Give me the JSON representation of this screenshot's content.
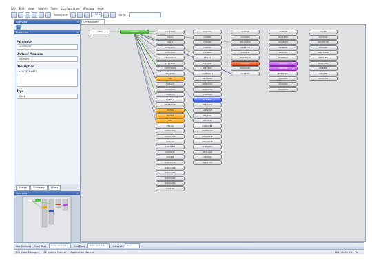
{
  "menu": [
    "File",
    "Edit",
    "View",
    "Search",
    "Tools",
    "Configuration",
    "Window",
    "Help"
  ],
  "toolbar": {
    "zoom_label": "Zoom Level",
    "zoom_value": "100%",
    "goto_label": "Go To:"
  },
  "left_panel": {
    "overview_title": "Overview",
    "properties_title": "Properties",
    "parameter_label": "Parameter",
    "parameter_value": "HESFRWEE",
    "units_label": "Units of Measure",
    "units_value": "(ESRWRT)",
    "description_label": "Description",
    "description_value": "HESI (ESRWRT)",
    "type_label": "Type",
    "type_value": "Stack",
    "tabs": [
      "Search",
      "Summary",
      "Filters"
    ],
    "overview_map_title": "Overview"
  },
  "document_tab": "CPPManager",
  "graph": {
    "nodes": [
      {
        "id": "n0",
        "label": "HESI",
        "style": "root",
        "col": 0,
        "row": 0
      },
      {
        "id": "n1",
        "label": "ESRWRT",
        "style": "green",
        "col": 1,
        "row": 0
      },
      {
        "id": "c2_0",
        "label": "CUTTORP",
        "style": "gray",
        "col": 2,
        "row": 0
      },
      {
        "id": "c2_1",
        "label": "CGAA",
        "style": "gray",
        "col": 2,
        "row": 1
      },
      {
        "id": "c2_2",
        "label": "CGLO",
        "style": "gray",
        "col": 2,
        "row": 2
      },
      {
        "id": "c2_3",
        "label": "CTGLASS",
        "style": "gray",
        "col": 2,
        "row": 3
      },
      {
        "id": "c2_4",
        "label": "CTPCLOU",
        "style": "gray",
        "col": 2,
        "row": 4
      },
      {
        "id": "c2_5",
        "label": "CTCLOUDHI",
        "style": "gray",
        "col": 2,
        "row": 5
      },
      {
        "id": "c2_6",
        "label": "CTGPMAP",
        "style": "gray",
        "col": 2,
        "row": 6
      },
      {
        "id": "c2_7",
        "label": "EARTHLOW",
        "style": "gray",
        "col": 2,
        "row": 7
      },
      {
        "id": "c2_8",
        "label": "EAGRUM",
        "style": "gray",
        "col": 2,
        "row": 8
      },
      {
        "id": "c2_9",
        "label": "HEI",
        "style": "orange",
        "col": 2,
        "row": 9
      },
      {
        "id": "c2_10",
        "label": "HANGCT",
        "style": "gray",
        "col": 2,
        "row": 10
      },
      {
        "id": "c2_11",
        "label": "HASDPHR",
        "style": "gray",
        "col": 2,
        "row": 11
      },
      {
        "id": "c2_12",
        "label": "HDENSITY",
        "style": "gray",
        "col": 2,
        "row": 12
      },
      {
        "id": "c2_13",
        "label": "HGEFLH",
        "style": "gray",
        "col": 2,
        "row": 13
      },
      {
        "id": "c2_14",
        "label": "HGRNLOW",
        "style": "gray",
        "col": 2,
        "row": 14
      },
      {
        "id": "c2_15",
        "label": "HOHM",
        "style": "orange",
        "col": 2,
        "row": 15
      },
      {
        "id": "c2_16",
        "label": "HOHLB",
        "style": "orange",
        "col": 2,
        "row": 16
      },
      {
        "id": "c2_17",
        "label": "HIC",
        "style": "orange",
        "col": 2,
        "row": 17
      },
      {
        "id": "c2_18",
        "label": "PWLOA",
        "style": "gray",
        "col": 2,
        "row": 18
      },
      {
        "id": "c2_19",
        "label": "PWMCHSA",
        "style": "gray",
        "col": 2,
        "row": 19
      },
      {
        "id": "c2_20",
        "label": "PWMCHLS",
        "style": "gray",
        "col": 2,
        "row": 20
      },
      {
        "id": "c2_21",
        "label": "SCRICO",
        "style": "gray",
        "col": 2,
        "row": 21
      },
      {
        "id": "c2_22",
        "label": "SLWTEMP",
        "style": "gray",
        "col": 2,
        "row": 22
      },
      {
        "id": "c2_23",
        "label": "SCRWOE",
        "style": "gray",
        "col": 2,
        "row": 23
      },
      {
        "id": "c2_24",
        "label": "SCRRIE",
        "style": "gray",
        "col": 2,
        "row": 24
      },
      {
        "id": "c2_25",
        "label": "SHELTEMP",
        "style": "gray",
        "col": 2,
        "row": 25
      },
      {
        "id": "c2_26",
        "label": "SWCOLBR",
        "style": "gray",
        "col": 2,
        "row": 26
      },
      {
        "id": "c2_27",
        "label": "SWCOLBR",
        "style": "gray",
        "col": 2,
        "row": 27
      },
      {
        "id": "c2_28",
        "label": "SWHOLBR",
        "style": "gray",
        "col": 2,
        "row": 28
      },
      {
        "id": "c2_29",
        "label": "SWHOLBR",
        "style": "gray",
        "col": 2,
        "row": 29
      },
      {
        "id": "c2_30",
        "label": "TCOTOR",
        "style": "gray",
        "col": 2,
        "row": 30
      },
      {
        "id": "c3_0",
        "label": "COLDTIG",
        "style": "gray",
        "col": 3,
        "row": 0
      },
      {
        "id": "c3_1",
        "label": "CGPPIN",
        "style": "gray",
        "col": 3,
        "row": 1
      },
      {
        "id": "c3_2",
        "label": "CTGAIN",
        "style": "gray",
        "col": 3,
        "row": 2
      },
      {
        "id": "c3_3",
        "label": "CTREAT",
        "style": "gray",
        "col": 3,
        "row": 3
      },
      {
        "id": "c3_4",
        "label": "CTDMSO",
        "style": "gray",
        "col": 3,
        "row": 4
      },
      {
        "id": "c3_5",
        "label": "DEGAS",
        "style": "gray",
        "col": 3,
        "row": 5
      },
      {
        "id": "c3_6",
        "label": "DIBHEAT",
        "style": "gray",
        "col": 3,
        "row": 6
      },
      {
        "id": "c3_7",
        "label": "DIESEAT",
        "style": "gray",
        "col": 3,
        "row": 7
      },
      {
        "id": "c3_8",
        "label": "DAMPLOLI",
        "style": "gray",
        "col": 3,
        "row": 8
      },
      {
        "id": "c3_9",
        "label": "SPLDVIBE",
        "style": "gray",
        "col": 3,
        "row": 9
      },
      {
        "id": "c3_10",
        "label": "LOWDTGT",
        "style": "gray",
        "col": 3,
        "row": 10
      },
      {
        "id": "c3_11",
        "label": "NORMTGL",
        "style": "gray",
        "col": 3,
        "row": 11
      },
      {
        "id": "c3_12",
        "label": "OVERPAS",
        "style": "gray",
        "col": 3,
        "row": 12
      },
      {
        "id": "c3_13",
        "label": "NTBURN",
        "style": "blue",
        "col": 3,
        "row": 13
      },
      {
        "id": "c3_14",
        "label": "PRE_MUX",
        "style": "gray",
        "col": 3,
        "row": 14
      },
      {
        "id": "c3_15",
        "label": "SCRNGSE",
        "style": "gray",
        "col": 3,
        "row": 15
      },
      {
        "id": "c3_16",
        "label": "SHUTTOL",
        "style": "gray",
        "col": 3,
        "row": 16
      },
      {
        "id": "c3_17",
        "label": "SHCDESE",
        "style": "gray",
        "col": 3,
        "row": 17
      },
      {
        "id": "c3_18",
        "label": "SWNGSEE",
        "style": "gray",
        "col": 3,
        "row": 18
      },
      {
        "id": "c3_19",
        "label": "SWPMGWA",
        "style": "gray",
        "col": 3,
        "row": 19
      },
      {
        "id": "c3_20",
        "label": "SWSGEDE",
        "style": "gray",
        "col": 3,
        "row": 20
      },
      {
        "id": "c3_21",
        "label": "SWVGEDE",
        "style": "gray",
        "col": 3,
        "row": 21
      },
      {
        "id": "c3_22",
        "label": "SHRDDEO",
        "style": "gray",
        "col": 3,
        "row": 22
      },
      {
        "id": "c3_23",
        "label": "UNTLOAD",
        "style": "gray",
        "col": 3,
        "row": 23
      },
      {
        "id": "c3_24",
        "label": "UNTOAD",
        "style": "gray",
        "col": 3,
        "row": 24
      },
      {
        "id": "c3_25",
        "label": "VARIPTOL",
        "style": "gray",
        "col": 3,
        "row": 25
      },
      {
        "id": "c4_0",
        "label": "COEHIR",
        "style": "gray",
        "col": 4,
        "row": 0
      },
      {
        "id": "c4_1",
        "label": "COCORR",
        "style": "gray",
        "col": 4,
        "row": 1
      },
      {
        "id": "c4_2",
        "label": "DELOGRHI",
        "style": "gray",
        "col": 4,
        "row": 2
      },
      {
        "id": "c4_3",
        "label": "GREATTE",
        "style": "gray",
        "col": 4,
        "row": 3
      },
      {
        "id": "c4_4",
        "label": "NHGSUP",
        "style": "gray",
        "col": 4,
        "row": 4
      },
      {
        "id": "c4_5",
        "label": "NORMLLIO",
        "style": "gray",
        "col": 4,
        "row": 5
      },
      {
        "id": "c4_6",
        "label": "NCHARM",
        "style": "red",
        "col": 4,
        "row": 6
      },
      {
        "id": "c4_7",
        "label": "ROWLOPA",
        "style": "gray",
        "col": 4,
        "row": 7
      },
      {
        "id": "c4_8",
        "label": "SOCPPIN",
        "style": "gray",
        "col": 4,
        "row": 8
      },
      {
        "id": "c5_0",
        "label": "COBHIR",
        "style": "gray",
        "col": 5,
        "row": 0
      },
      {
        "id": "c5_1",
        "label": "GCLSTHR",
        "style": "gray",
        "col": 5,
        "row": 1
      },
      {
        "id": "c5_2",
        "label": "GKGBHIR",
        "style": "gray",
        "col": 5,
        "row": 2
      },
      {
        "id": "c5_3",
        "label": "NKMRPR",
        "style": "gray",
        "col": 5,
        "row": 3
      },
      {
        "id": "c5_4",
        "label": "NKPOHR",
        "style": "gray",
        "col": 5,
        "row": 4
      },
      {
        "id": "c5_5",
        "label": "NCMHOR",
        "style": "gray",
        "col": 5,
        "row": 5
      },
      {
        "id": "c5_6",
        "label": "NOBLEE",
        "style": "purple",
        "col": 5,
        "row": 6
      },
      {
        "id": "c5_7",
        "label": "NOBTRH",
        "style": "purple",
        "col": 5,
        "row": 7
      },
      {
        "id": "c5_8",
        "label": "PRESHOR",
        "style": "gray",
        "col": 5,
        "row": 8
      },
      {
        "id": "c5_9",
        "label": "STACKPL",
        "style": "gray",
        "col": 5,
        "row": 9
      },
      {
        "id": "c5_10",
        "label": "VOGHRR",
        "style": "gray",
        "col": 5,
        "row": 10
      },
      {
        "id": "c5_11",
        "label": "VOCPPHR",
        "style": "gray",
        "col": 5,
        "row": 11
      },
      {
        "id": "c6_0",
        "label": "COLBR",
        "style": "gray",
        "col": 6,
        "row": 0
      },
      {
        "id": "c6_1",
        "label": "COTGNS",
        "style": "gray",
        "col": 6,
        "row": 1
      },
      {
        "id": "c6_2",
        "label": "GEOPTHIN",
        "style": "gray",
        "col": 6,
        "row": 2
      },
      {
        "id": "c6_3",
        "label": "NHGLBR",
        "style": "gray",
        "col": 6,
        "row": 3
      },
      {
        "id": "c6_4",
        "label": "NHOTORB",
        "style": "gray",
        "col": 6,
        "row": 4
      },
      {
        "id": "c6_5",
        "label": "PRESLBE",
        "style": "gray",
        "col": 6,
        "row": 5
      },
      {
        "id": "c6_6",
        "label": "PRSTOHA",
        "style": "gray",
        "col": 6,
        "row": 6
      },
      {
        "id": "c6_7",
        "label": "SHBLBR",
        "style": "gray",
        "col": 6,
        "row": 7
      },
      {
        "id": "c6_8",
        "label": "VOCLBR",
        "style": "gray",
        "col": 6,
        "row": 8
      },
      {
        "id": "c6_9",
        "label": "VOLTOHR",
        "style": "gray",
        "col": 6,
        "row": 9
      }
    ],
    "edge_targets": [
      "c2_0",
      "c2_3",
      "c2_6",
      "c2_9",
      "c2_12",
      "c2_15",
      "c2_16",
      "c2_17",
      "c3_4",
      "c3_8",
      "c3_11",
      "c3_13",
      "c3_17",
      "c4_2",
      "c4_6",
      "c4_8"
    ]
  },
  "bottom_bar": {
    "use_defaults": "Use Defaults",
    "start_date_label": "Start Date",
    "start_date_value": "Enter start date",
    "end_date_label": "End Date",
    "end_date_value": "Enter end date",
    "interval_label": "Interval",
    "interval_value": "Hour"
  },
  "status_bar": {
    "items": [
      "SCI (Data Manager)",
      "SE System Monitor",
      "Application Monitor"
    ],
    "datetime": "8/17/2009 3:01 PM"
  }
}
